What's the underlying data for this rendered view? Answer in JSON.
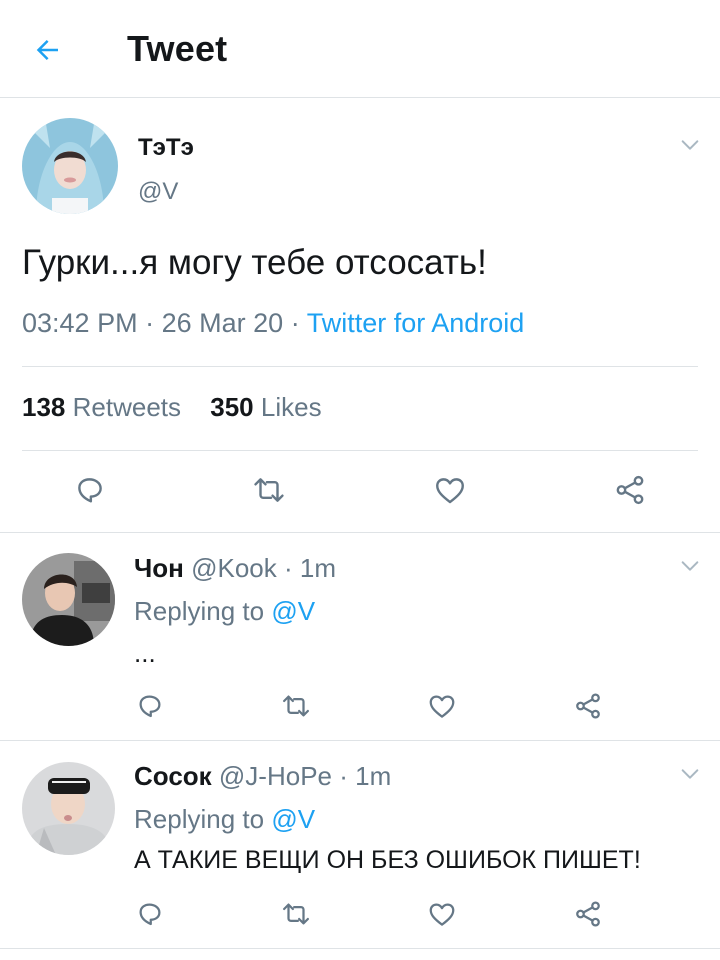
{
  "header": {
    "title": "Tweet",
    "back_icon": "arrow-left-icon",
    "accent": "#1da1f2"
  },
  "main_tweet": {
    "display_name": "ТэТэ",
    "handle": "@V",
    "text": "Гурки...я могу тебе отсосать!",
    "time": "03:42 PM",
    "separator": "·",
    "date": "26 Mar 20",
    "source": "Twitter for Android",
    "retweets_count": "138",
    "retweets_label": "Retweets",
    "likes_count": "350",
    "likes_label": "Likes"
  },
  "replies": [
    {
      "display_name": "Чон",
      "handle": "@Kook",
      "time": "· 1m",
      "replying_label": "Replying to",
      "mention": "@V",
      "text": "..."
    },
    {
      "display_name": "Сосок",
      "handle": "@J-HoPe",
      "time": "· 1m",
      "replying_label": "Replying to",
      "mention": "@V",
      "text": "А ТАКИЕ ВЕЩИ ОН БЕЗ ОШИБОК ПИШЕТ!"
    }
  ],
  "icons": [
    "reply-icon",
    "retweet-icon",
    "like-icon",
    "share-icon",
    "chevron-down-icon"
  ],
  "colors": {
    "text": "#14171a",
    "secondary": "#657786",
    "link": "#1da1f2",
    "divider": "#dfe3e6"
  }
}
